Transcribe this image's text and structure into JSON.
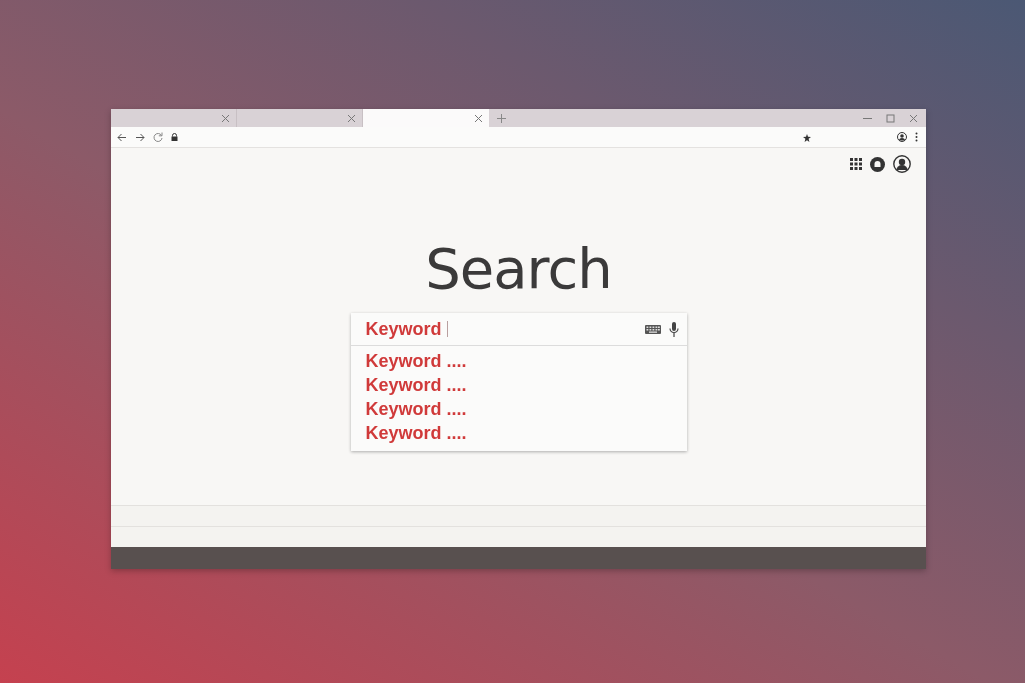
{
  "tabs": [
    {
      "selected": false
    },
    {
      "selected": false
    },
    {
      "selected": true
    }
  ],
  "heading": "Search",
  "search": {
    "value": "Keyword"
  },
  "suggestions": [
    "Keyword ....",
    "Keyword ....",
    "Keyword ....",
    "Keyword ...."
  ]
}
